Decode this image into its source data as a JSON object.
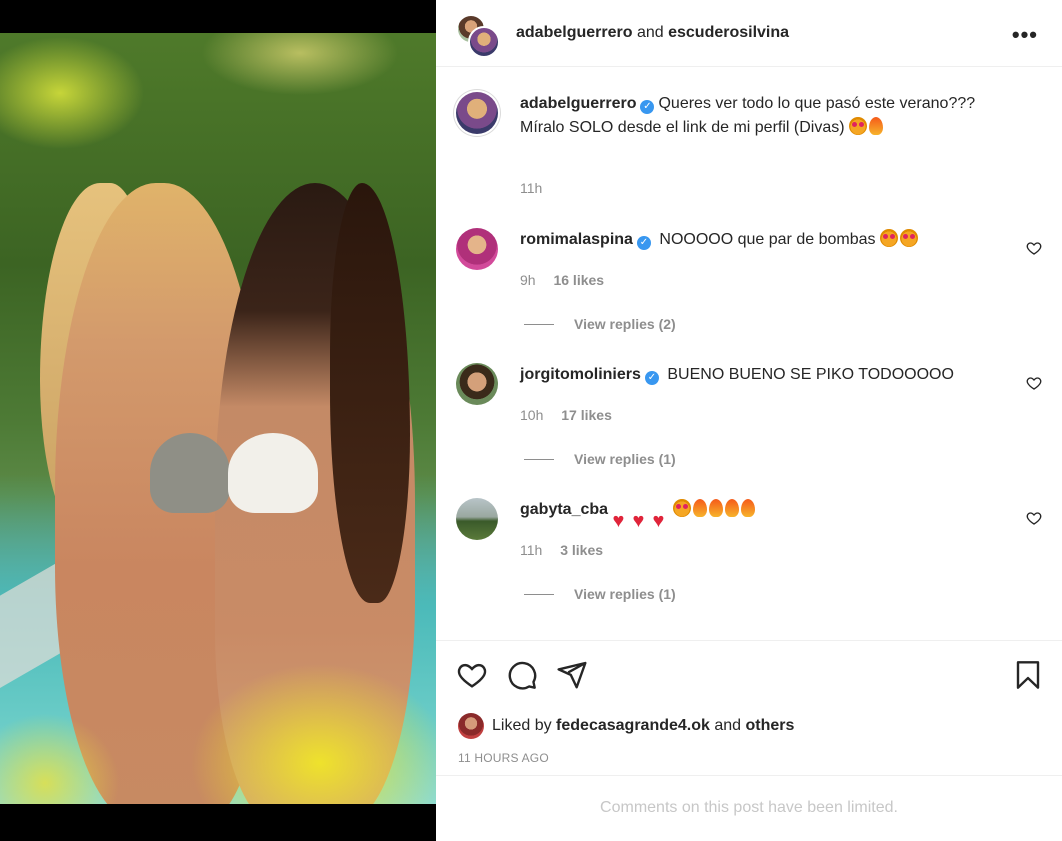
{
  "post": {
    "author": "adabelguerrero",
    "connector": "and",
    "collaborator": "escuderosilvina",
    "caption_user": "adabelguerrero",
    "caption_line1": "Queres ver todo lo que pasó este verano???",
    "caption_line2": "Míralo SOLO desde el link de mi perfil (Divas)",
    "caption_time": "11h"
  },
  "comments": [
    {
      "user": "romimalaspina",
      "verified": true,
      "text": "NOOOOO que par de bombas",
      "emoji": [
        "star-eyes",
        "star-eyes"
      ],
      "time": "9h",
      "likes": "16 likes",
      "replies": "View replies (2)"
    },
    {
      "user": "jorgitomoliniers",
      "verified": true,
      "text": "BUENO BUENO SE PIKO TODOOOOO",
      "emoji": [],
      "time": "10h",
      "likes": "17 likes",
      "replies": "View replies (1)"
    },
    {
      "user": "gabyta_cba",
      "verified": false,
      "text": "",
      "emoji": [
        "heart",
        "heart",
        "heart",
        "star-eyes",
        "fire",
        "fire",
        "fire",
        "fire"
      ],
      "time": "11h",
      "likes": "3 likes",
      "replies": "View replies (1)"
    }
  ],
  "actions": {
    "icons": [
      "heart-icon",
      "comment-icon",
      "share-icon",
      "bookmark-icon"
    ],
    "liked_prefix": "Liked by",
    "liked_user": "fedecasagrande4.ok",
    "liked_and": "and",
    "liked_others": "others",
    "timestamp": "11 HOURS AGO"
  },
  "footer": {
    "limited_text": "Comments on this post have been limited."
  },
  "colors": {
    "verified": "#3897f0",
    "muted": "#8e8e8e",
    "text": "#262626"
  }
}
